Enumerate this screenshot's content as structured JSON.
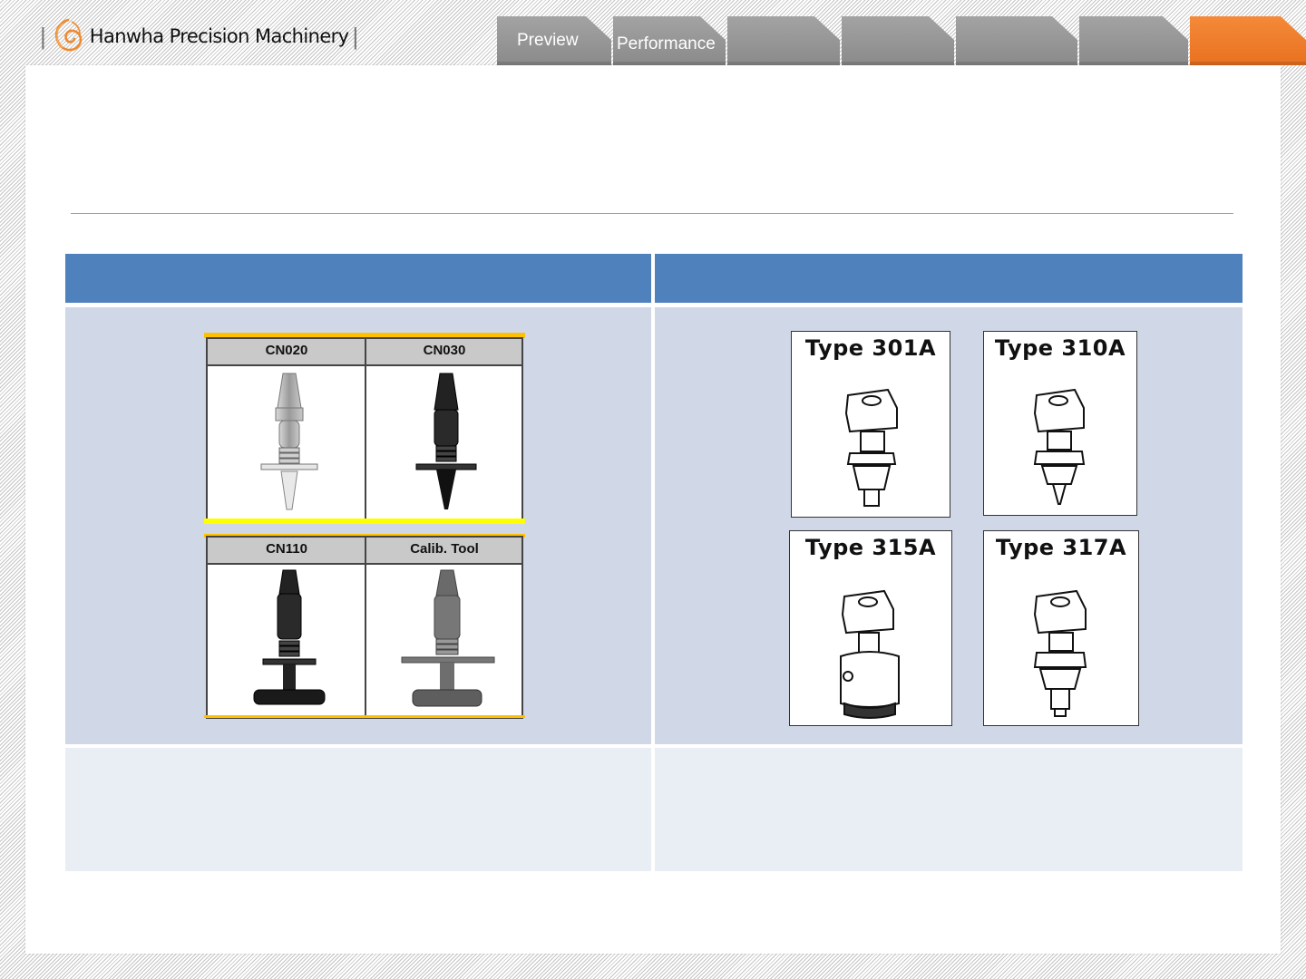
{
  "header": {
    "brand": "Hanwha Precision Machinery",
    "tabs": [
      {
        "label": "Preview",
        "active": false
      },
      {
        "label": "Performance",
        "active": false
      },
      {
        "label": "",
        "active": false
      },
      {
        "label": "",
        "active": false
      },
      {
        "label": "",
        "active": false
      },
      {
        "label": "",
        "active": false
      },
      {
        "label": "",
        "active": true
      }
    ]
  },
  "colors": {
    "accent_orange": "#e8711f",
    "table_header": "#4f81bd",
    "row_image": "#d0d8e8",
    "row_text": "#e9edf4",
    "rule": "#e8894a"
  },
  "table": {
    "header": [
      "",
      ""
    ],
    "nozzles_left": {
      "top_labels": [
        "CN020",
        "CN030"
      ],
      "bottom_labels": [
        "CN110",
        "Calib. Tool"
      ]
    },
    "nozzles_right": {
      "types": [
        "Type 301A",
        "Type 310A",
        "Type 315A",
        "Type 317A"
      ]
    },
    "notes": [
      "",
      ""
    ]
  }
}
